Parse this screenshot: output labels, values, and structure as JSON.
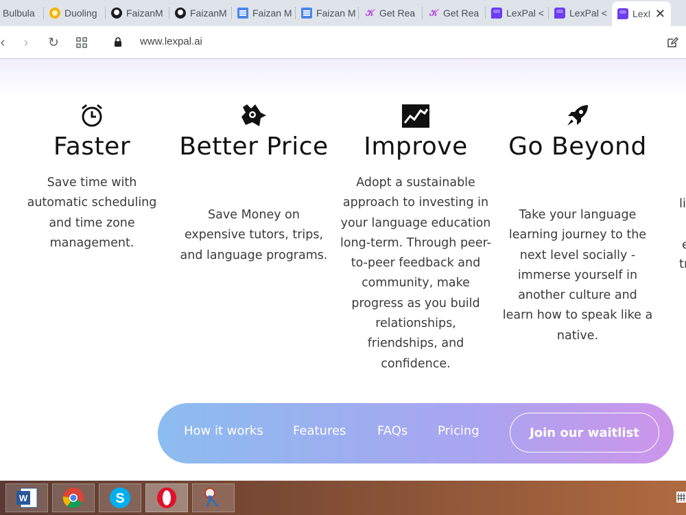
{
  "tabs": [
    {
      "label": "Bulbula",
      "favicon": "bulbula-icon"
    },
    {
      "label": "Duoling",
      "favicon": "duolingo-icon"
    },
    {
      "label": "FaizanM",
      "favicon": "github-icon"
    },
    {
      "label": "FaizanM",
      "favicon": "github-icon"
    },
    {
      "label": "Faizan M",
      "favicon": "docs-icon"
    },
    {
      "label": "Faizan M",
      "favicon": "docs-icon"
    },
    {
      "label": "Get Rea",
      "favicon": "getready-icon"
    },
    {
      "label": "Get Rea",
      "favicon": "getready-icon"
    },
    {
      "label": "LexPal <",
      "favicon": "lexpal-icon"
    },
    {
      "label": "LexPal <",
      "favicon": "lexpal-icon"
    },
    {
      "label": "LexP",
      "favicon": "lexpal-icon",
      "active": true
    }
  ],
  "address_bar": {
    "url": "www.lexpal.ai"
  },
  "features": [
    {
      "icon": "alarm-clock-icon",
      "title": "Faster",
      "description": "Save time with automatic scheduling and time zone management."
    },
    {
      "icon": "flying-money-icon",
      "title": "Better Price",
      "description": "Save Money on expensive tutors, trips, and language programs."
    },
    {
      "icon": "chart-trend-icon",
      "title": "Improve",
      "description": "Adopt a sustainable approach to investing in your language education long-term. Through peer-to-peer feedback and community, make progress as you build relationships, friendships, and confidence."
    },
    {
      "icon": "rocket-icon",
      "title": "Go Beyond",
      "description": "Take your language learning journey to the next level socially - immerse yourself in another culture and learn how to speak like a native."
    }
  ],
  "partial_text": [
    "li",
    "e",
    "tr"
  ],
  "nav": {
    "links": [
      "How it works",
      "Features",
      "FAQs",
      "Pricing"
    ],
    "cta": "Join our waitlist",
    "gradient": [
      "#8cbcf0",
      "#a9a5f0",
      "#cd95ea"
    ]
  },
  "taskbar": {
    "apps": [
      "word-icon",
      "chrome-icon",
      "skype-icon",
      "opera-icon",
      "snipping-tool-icon"
    ]
  }
}
